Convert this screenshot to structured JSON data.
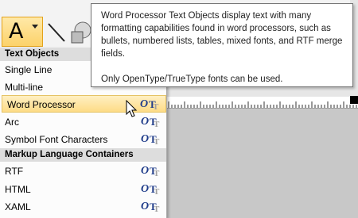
{
  "toolbar": {
    "text_tool_glyph": "A",
    "text_tool_icon": "text-a-icon",
    "line_tool_icon": "line-icon",
    "shape_tool_icon": "shape-icon"
  },
  "tooltip": {
    "paragraph1": "Word Processor Text Objects display text with many formatting capabilities found in word processors, such as bullets, numbered lists, tables, mixed fonts, and RTF merge fields.",
    "paragraph2": "Only OpenType/TrueType fonts can be used."
  },
  "menu": {
    "sections": [
      {
        "header": "Text Objects",
        "items": [
          {
            "label": "Single Line",
            "font_icons": false,
            "selected": false
          },
          {
            "label": "Multi-line",
            "font_icons": false,
            "selected": false
          },
          {
            "label": "Word Processor",
            "font_icons": true,
            "selected": true
          },
          {
            "label": "Arc",
            "font_icons": true,
            "selected": false
          },
          {
            "label": "Symbol Font Characters",
            "font_icons": true,
            "selected": false
          }
        ]
      },
      {
        "header": "Markup Language Containers",
        "items": [
          {
            "label": "RTF",
            "font_icons": true,
            "selected": false
          },
          {
            "label": "HTML",
            "font_icons": true,
            "selected": false
          },
          {
            "label": "XAML",
            "font_icons": true,
            "selected": false
          }
        ]
      }
    ],
    "font_icon_glyphs": {
      "opentype": "O",
      "truetype": "T"
    }
  },
  "colors": {
    "selected_bg": "#fddc86",
    "header_bg": "#dddddd",
    "font_icon": "#1f3c8a"
  }
}
